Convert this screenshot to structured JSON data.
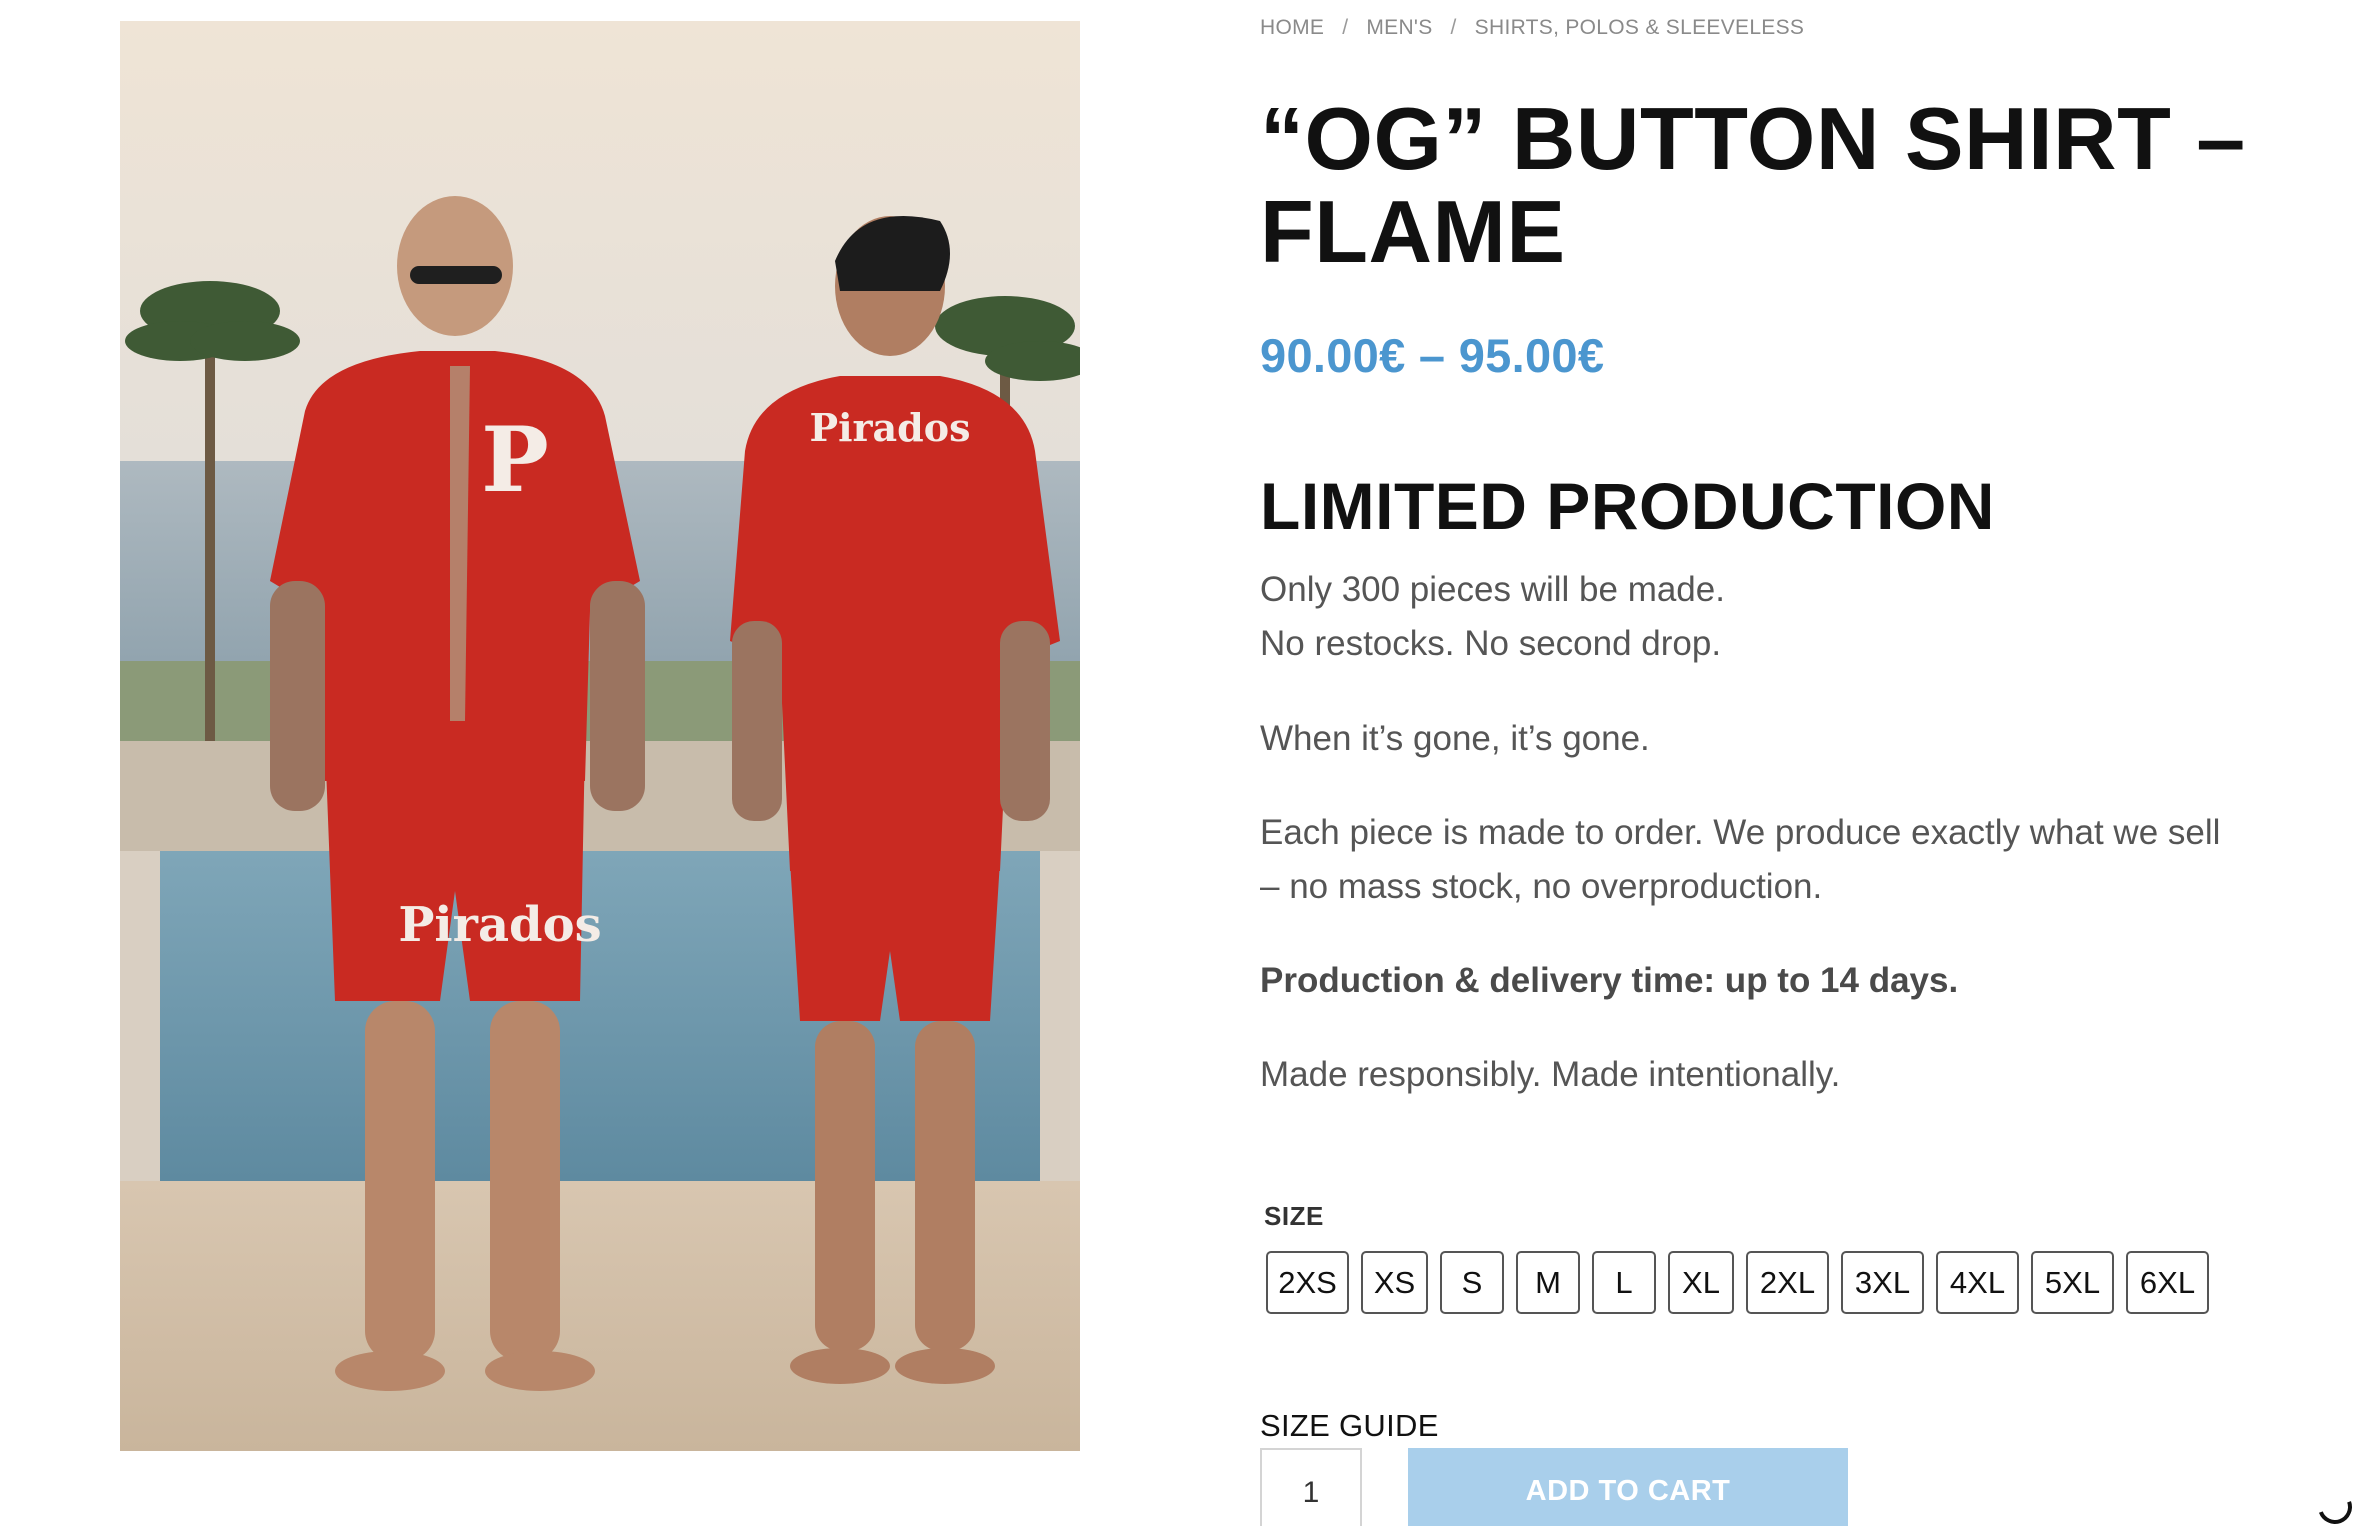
{
  "breadcrumb": {
    "home": "HOME",
    "mens": "MEN'S",
    "category": "SHIRTS, POLOS & SLEEVELESS",
    "separator": "/"
  },
  "product": {
    "title_line1": "“OG” BUTTON SHIRT –",
    "title_line2": "FLAME",
    "price": "90.00€ – 95.00€",
    "image_logo_text": "Pirados",
    "image_monogram": "P"
  },
  "description": {
    "heading": "LIMITED PRODUCTION",
    "p1_line1": "Only 300 pieces will be made.",
    "p1_line2": "No restocks. No second drop.",
    "p2": "When it’s gone, it’s gone.",
    "p3_line1": "Each piece is made to order. We produce exactly what we sell",
    "p3_line2": "– no mass stock, no overproduction.",
    "p4": "Production & delivery time: up to 14 days.",
    "p5": "Made responsibly. Made intentionally."
  },
  "size": {
    "label": "SIZE",
    "options": [
      "2XS",
      "XS",
      "S",
      "M",
      "L",
      "XL",
      "2XL",
      "3XL",
      "4XL",
      "5XL",
      "6XL"
    ]
  },
  "size_guide_label": "SIZE GUIDE",
  "quantity": {
    "value": "1"
  },
  "add_to_cart_label": "ADD TO CART",
  "colors": {
    "price": "#4b96cf",
    "add_to_cart_bg": "#a9cfeb",
    "shirt_red": "#c92a22"
  }
}
